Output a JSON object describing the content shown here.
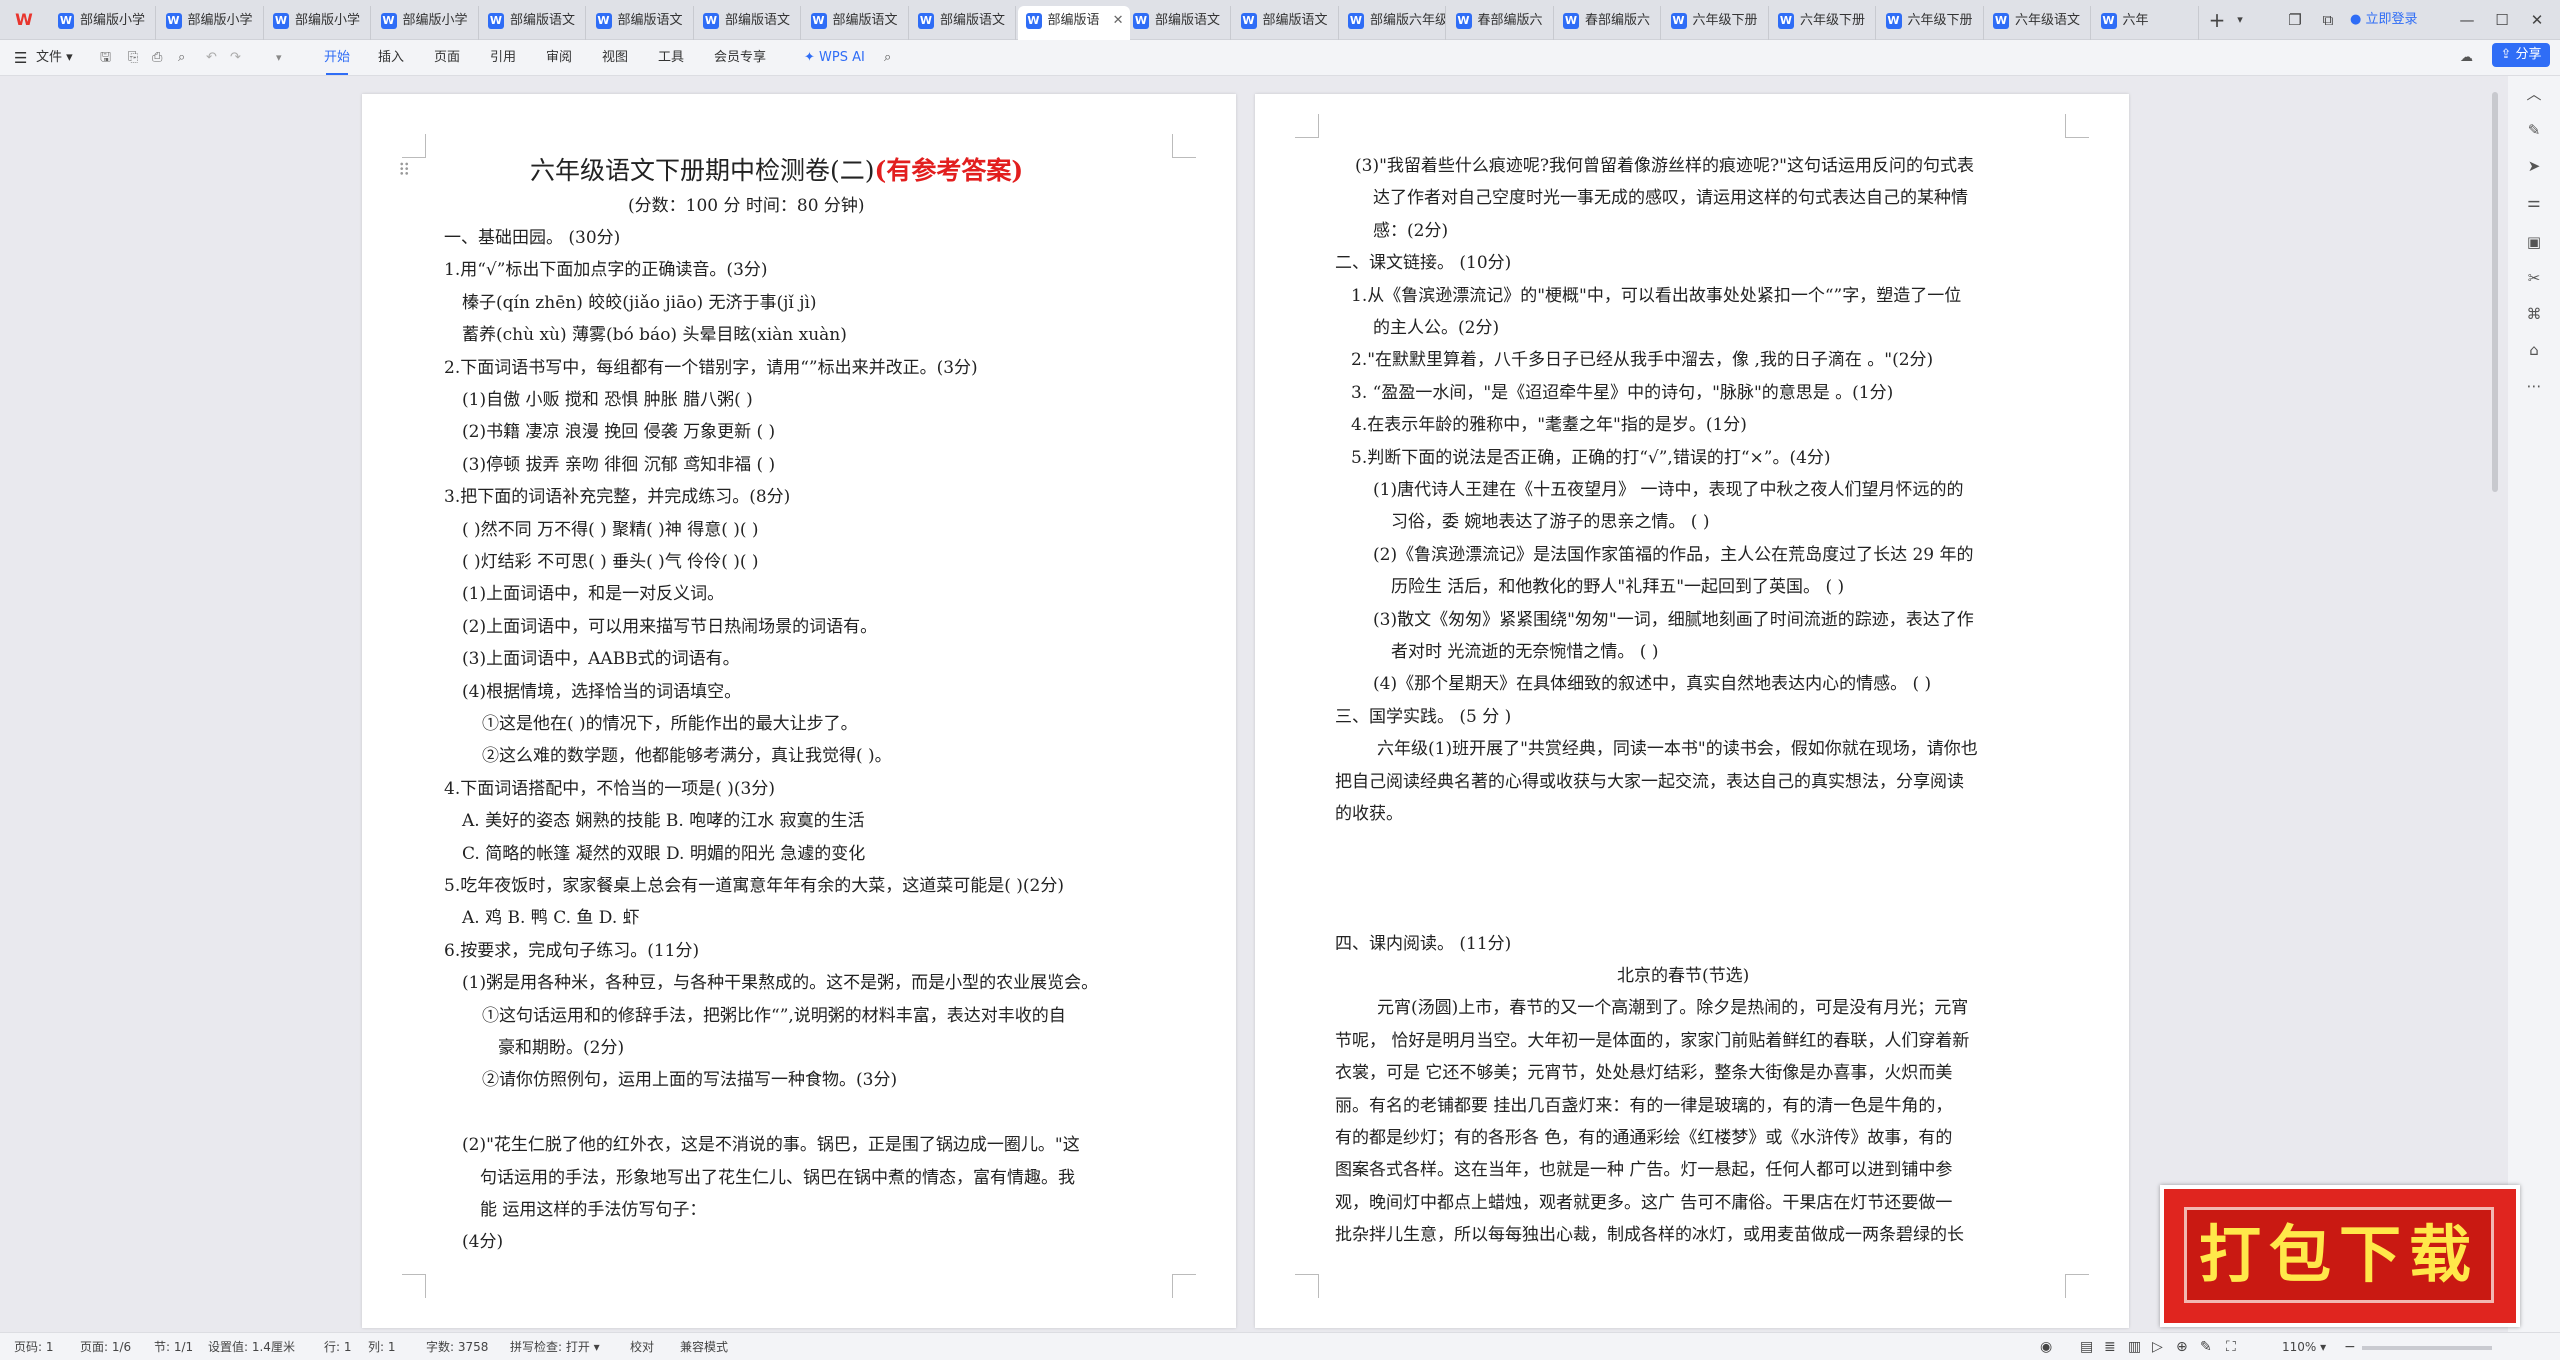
{
  "tabs": [
    {
      "label": "部编版小学",
      "active": false
    },
    {
      "label": "部编版小学",
      "active": false
    },
    {
      "label": "部编版小学",
      "active": false
    },
    {
      "label": "部编版小学",
      "active": false
    },
    {
      "label": "部编版语文",
      "active": false
    },
    {
      "label": "部编版语文",
      "active": false
    },
    {
      "label": "部编版语文",
      "active": false
    },
    {
      "label": "部编版语文",
      "active": false
    },
    {
      "label": "部编版语文",
      "active": false
    },
    {
      "label": "部编版语",
      "active": true
    },
    {
      "label": "部编版语文",
      "active": false
    },
    {
      "label": "部编版语文",
      "active": false
    },
    {
      "label": "部编版六年级",
      "active": false
    },
    {
      "label": "春部编版六",
      "active": false
    },
    {
      "label": "春部编版六",
      "active": false
    },
    {
      "label": "六年级下册",
      "active": false
    },
    {
      "label": "六年级下册",
      "active": false
    },
    {
      "label": "六年级下册",
      "active": false
    },
    {
      "label": "六年级语文",
      "active": false
    },
    {
      "label": "六年",
      "active": false
    }
  ],
  "titlebar": {
    "login": "立即登录"
  },
  "menu": {
    "file": "文件",
    "items": [
      "开始",
      "插入",
      "页面",
      "引用",
      "审阅",
      "视图",
      "工具",
      "会员专享"
    ],
    "active": "开始",
    "ai": "WPS AI",
    "share": "分享"
  },
  "page1": [
    "一、基础田园。 (30分)",
    "1.用“√”标出下面加点字的正确读音。(3分)",
    "榛子(qín  zhēn) 皎皎(jiǎo  jiāo) 无济于事(jǐ jì)",
    "蓄养(chù  xù)  薄雾(bó  báo)  头晕目眩(xiàn  xuàn)",
    "2.下面词语书写中，每组都有一个错别字，请用“”标出来并改正。(3分)",
    "(1)自傲   小贩   搅和   恐惧   肿胀   腊八粥(  )",
    "(2)书籍   凄凉   浪漫   挽回   侵袭   万象更新       (   )",
    "(3)停顿   拔弄   亲吻   徘徊   沉郁   鸢知非福       (   )",
    "3.把下面的词语补充完整，并完成练习。(8分)",
    "(  )然不同  万不得(  ) 聚精(  )神  得意(  )(  )",
    "(  )灯结彩  不可思(  ) 垂头(  )气  伶伶(  )(  )",
    "(1)上面词语中，和是一对反义词。",
    "(2)上面词语中，可以用来描写节日热闹场景的词语有。",
    "(3)上面词语中，AABB式的词语有。",
    "(4)根据情境，选择恰当的词语填空。",
    "①这是他在(          )的情况下，所能作出的最大让步了。",
    "②这么难的数学题，他都能够考满分，真让我觉得(         )。",
    "4.下面词语搭配中，不恰当的一项是(  )(3分)",
    "A. 美好的姿态  娴熟的技能        B. 咆哮的江水  寂寞的生活",
    "C. 简略的帐篷  凝然的双眼        D. 明媚的阳光  急遽的变化",
    "5.吃年夜饭时，家家餐桌上总会有一道寓意年年有余的大菜，这道菜可能是(  )(2分)",
    "A. 鸡            B. 鸭            C. 鱼            D. 虾",
    "6.按要求，完成句子练习。(11分)",
    "(1)粥是用各种米，各种豆，与各种干果熬成的。这不是粥，而是小型的农业展览会。",
    "①这句话运用和的修辞手法，把粥比作“”,说明粥的材料丰富，表达对丰收的自",
    "豪和期盼。(2分)",
    "②请你仿照例句，运用上面的写法描写一种食物。(3分)",
    "",
    "(2)\"花生仁脱了他的红外衣，这是不消说的事。锅巴，正是围了锅边成一圈儿。\"这",
    "句话运用的手法，形象地写出了花生仁儿、锅巴在锅中煮的情态，富有情趣。我",
    "能 运用这样的手法仿写句子：",
    "(4分)"
  ],
  "page1_title": "六年级语文下册期中检测卷(二)",
  "page1_title_red": "(有参考答案)",
  "page1_subtitle": "(分数：100 分      时间：80 分钟)",
  "page2": [
    "(3)\"我留着些什么痕迹呢?我何曾留着像游丝样的痕迹呢?\"这句话运用反问的句式表",
    "达了作者对自己空度时光一事无成的感叹，请运用这样的句式表达自己的某种情",
    "感：(2分)",
    "二、课文链接。 (10分)",
    "1.从《鲁滨逊漂流记》的\"梗概\"中，可以看出故事处处紧扣一个“”字，塑造了一位",
    "的主人公。(2分)",
    "2.\"在默默里算着，八千多日子已经从我手中溜去，像 ,我的日子滴在 。\"(2分)",
    "3. “盈盈一水间，\"是《迢迢牵牛星》中的诗句，\"脉脉\"的意思是    。(1分)",
    "4.在表示年龄的雅称中，\"耄耋之年\"指的是岁。(1分)",
    "5.判断下面的说法是否正确，正确的打“√”,错误的打“×”。(4分)",
    "(1)唐代诗人王建在《十五夜望月》 一诗中，表现了中秋之夜人们望月怀远的的",
    "习俗，委 婉地表达了游子的思亲之情。                              (   )",
    "(2)《鲁滨逊漂流记》是法国作家笛福的作品，主人公在荒岛度过了长达 29 年的",
    "历险生 活后，和他教化的野人\"礼拜五\"一起回到了英国。                (   )",
    "(3)散文《匆匆》紧紧围绕\"匆匆\"一词，细腻地刻画了时间流逝的踪迹，表达了作",
    "者对时 光流逝的无奈惋惜之情。                                    (   )",
    "(4)《那个星期天》在具体细致的叙述中，真实自然地表达内心的情感。    (   )",
    "三、国学实践。 (5 分 )",
    "六年级(1)班开展了\"共赏经典，同读一本书\"的读书会，假如你就在现场，请你也",
    "把自己阅读经典名著的心得或收获与大家一起交流，表达自己的真实想法，分享阅读",
    "的收获。",
    "",
    "",
    "",
    "四、课内阅读。 (11分)",
    "北京的春节(节选)",
    "元宵(汤圆)上市，春节的又一个高潮到了。除夕是热闹的，可是没有月光；元宵",
    "节呢， 恰好是明月当空。大年初一是体面的，家家门前贴着鲜红的春联，人们穿着新",
    "衣裳，可是 它还不够美；元宵节，处处悬灯结彩，整条大街像是办喜事，火炽而美",
    "丽。有名的老铺都要  挂出几百盏灯来：有的一律是玻璃的，有的清一色是牛角的，",
    "有的都是纱灯；有的各形各  色，有的通通彩绘《红楼梦》或《水浒传》故事，有的",
    "图案各式各样。这在当年，也就是一种  广告。灯一悬起，任何人都可以进到铺中参",
    "观，晚间灯中都点上蜡烛，观者就更多。这广  告可不庸俗。干果店在灯节还要做一",
    "批杂拌儿生意，所以每每独出心裁，制成各样的冰灯，或用麦苗做成一两条碧绿的长"
  ],
  "status": {
    "page": "页码: 1",
    "pages": "页面: 1/6",
    "section": "节: 1/1",
    "setting": "设置值: 1.4厘米",
    "row": "行: 1",
    "col": "列: 1",
    "words": "字数: 3758",
    "spell": "拼写检查: 打开",
    "proof": "校对",
    "compat": "兼容模式",
    "zoom": "110%"
  },
  "badge": "打包下载"
}
